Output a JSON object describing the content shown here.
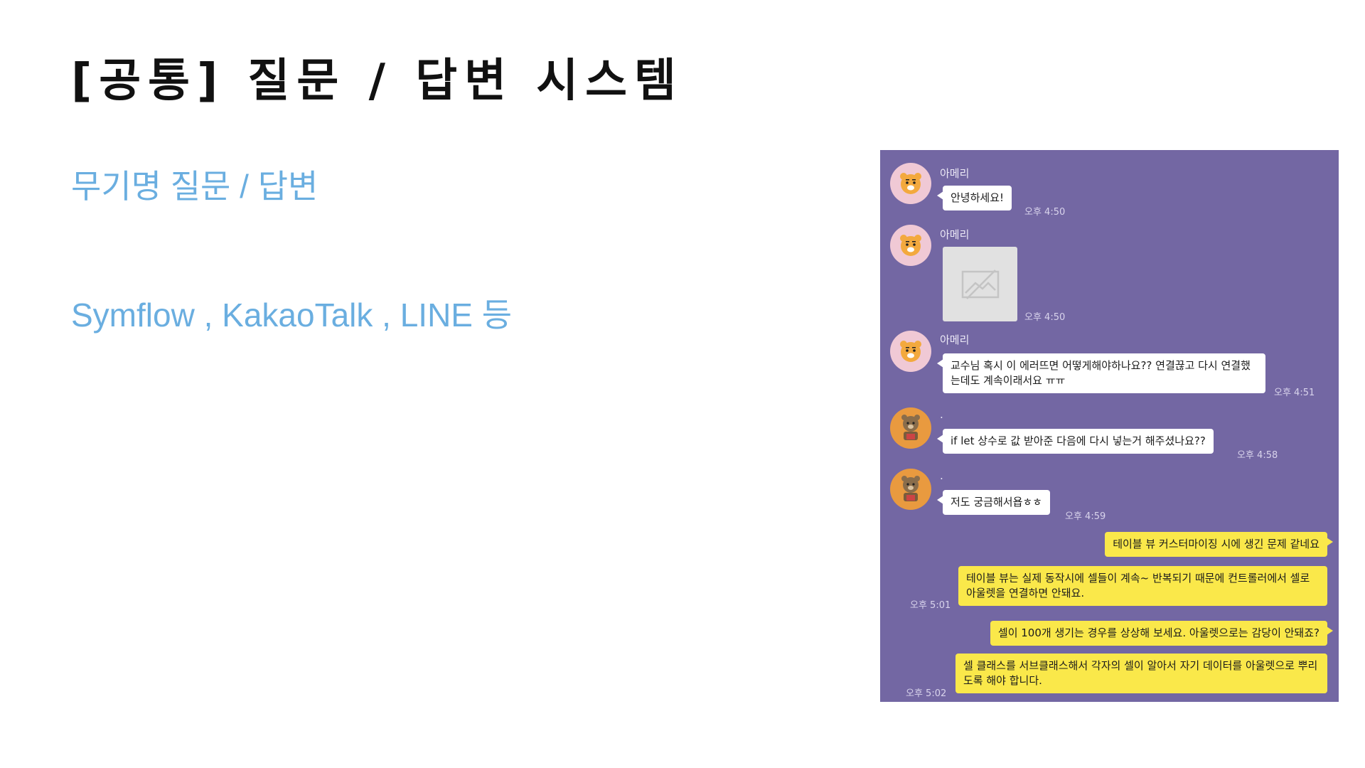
{
  "slide": {
    "title": "[공통] 질문 / 답변 시스템",
    "subtitle1": "무기명 질문 / 답변",
    "subtitle2": "Symflow , KakaoTalk , LINE 등"
  },
  "chat": {
    "background": "#7367a3",
    "messages": [
      {
        "sender": "아메리",
        "text": "안녕하세요!",
        "time": "오후 4:50"
      },
      {
        "sender": "아메리",
        "text": "",
        "time": "오후 4:50",
        "attachment_icon": "image-placeholder-icon"
      },
      {
        "sender": "아메리",
        "text": "교수님 혹시 이 에러뜨면 어떻게해야하나요?? 연결끊고 다시 연결했는데도 계속이래서요 ㅠㅠ",
        "time": "오후 4:51"
      },
      {
        "sender": ".",
        "text": "if let 상수로 값 받아준 다음에 다시 넣는거 해주셨나요??",
        "time": "오후 4:58"
      },
      {
        "sender": ".",
        "text": "저도 궁금해서욥ㅎㅎ",
        "time": "오후 4:59"
      },
      {
        "text": "테이블 뷰 커스터마이징 시에 생긴 문제 같네요",
        "time": ""
      },
      {
        "text": "테이블 뷰는 실제 동작시에 셀들이 계속~ 반복되기 때문에 컨트롤러에서 셀로 아울렛을 연결하면 안돼요.",
        "time": "오후 5:01"
      },
      {
        "text": "셀이 100개 생기는 경우를 상상해 보세요. 아울렛으로는 감당이 안돼죠?",
        "time": ""
      },
      {
        "text": "셀 클래스를 서브클래스해서 각자의 셀이 알아서 자기 데이터를 아울렛으로 뿌리도록 해야 합니다.",
        "time": "오후 5:02"
      }
    ]
  },
  "colors": {
    "title": "#111111",
    "subtitle": "#6aaee0",
    "bubble_in": "#ffffff",
    "bubble_out": "#fae84a"
  }
}
